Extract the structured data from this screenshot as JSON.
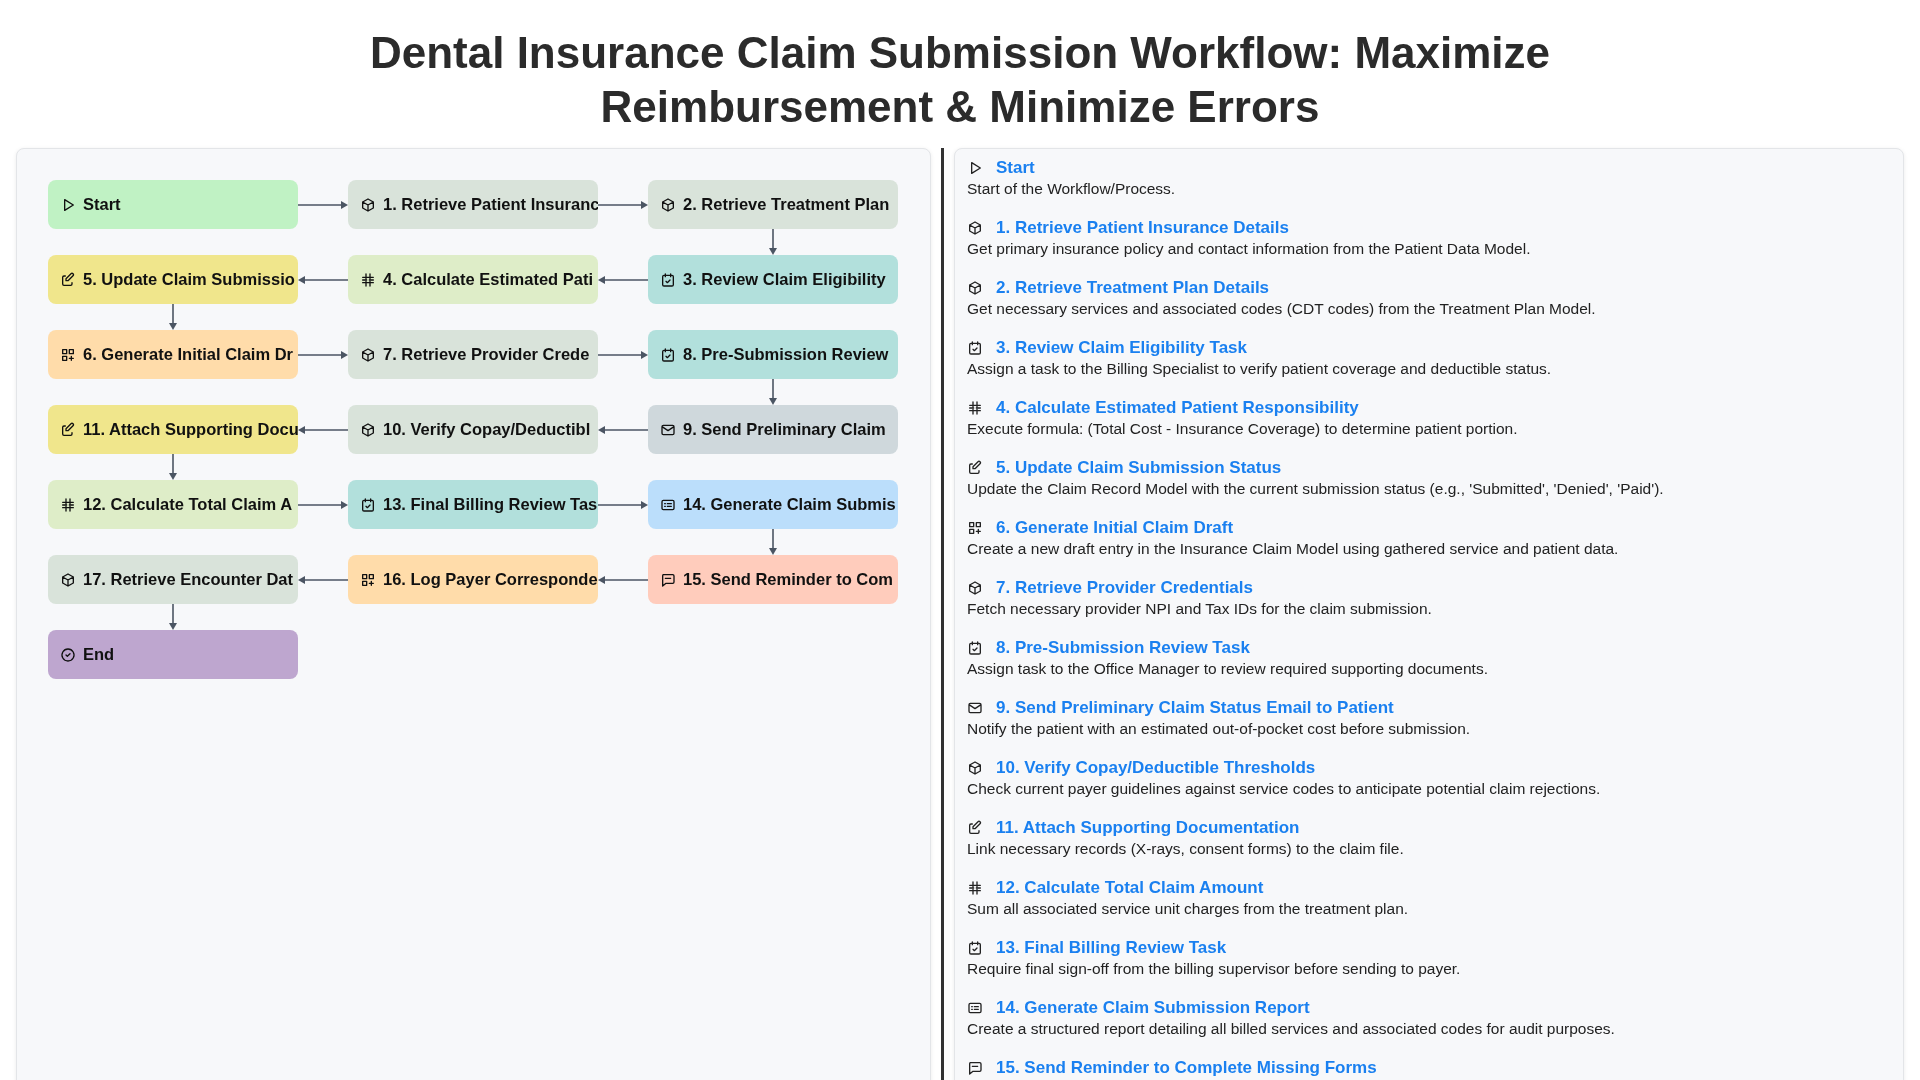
{
  "title": "Dental Insurance Claim Submission Workflow: Maximize Reimbursement & Minimize Errors",
  "flowchart": {
    "rows": [
      {
        "reversed": false,
        "nodes": [
          {
            "label": "Start",
            "kind": "start"
          },
          {
            "label": "1. Retrieve Patient Insuranc",
            "kind": "retrieve"
          },
          {
            "label": "2. Retrieve Treatment Plan",
            "kind": "retrieve"
          }
        ]
      },
      {
        "reversed": true,
        "nodes": [
          {
            "label": "5. Update Claim Submissio",
            "kind": "update"
          },
          {
            "label": "4. Calculate Estimated Pati",
            "kind": "calculate"
          },
          {
            "label": "3. Review Claim Eligibility",
            "kind": "task"
          }
        ]
      },
      {
        "reversed": false,
        "nodes": [
          {
            "label": "6. Generate Initial Claim Dr",
            "kind": "add"
          },
          {
            "label": "7. Retrieve Provider Crede",
            "kind": "retrieve"
          },
          {
            "label": "8. Pre-Submission Review",
            "kind": "task"
          }
        ]
      },
      {
        "reversed": true,
        "nodes": [
          {
            "label": "11. Attach Supporting Docu",
            "kind": "update"
          },
          {
            "label": "10. Verify Copay/Deductibl",
            "kind": "retrieve"
          },
          {
            "label": "9. Send Preliminary Claim",
            "kind": "email"
          }
        ]
      },
      {
        "reversed": false,
        "nodes": [
          {
            "label": "12. Calculate Total Claim A",
            "kind": "calculate"
          },
          {
            "label": "13. Final Billing Review Tas",
            "kind": "task"
          },
          {
            "label": "14. Generate Claim Submis",
            "kind": "report"
          }
        ]
      },
      {
        "reversed": true,
        "nodes": [
          {
            "label": "17. Retrieve Encounter Dat",
            "kind": "retrieve"
          },
          {
            "label": "16. Log Payer Corresponde",
            "kind": "add"
          },
          {
            "label": "15. Send Reminder to Com",
            "kind": "sms"
          }
        ]
      },
      {
        "nodes": [
          {
            "label": "End",
            "kind": "end"
          }
        ]
      }
    ]
  },
  "details": [
    {
      "kind": "start",
      "title": "Start",
      "description": "Start of the Workflow/Process."
    },
    {
      "kind": "retrieve",
      "title": "1. Retrieve Patient Insurance Details",
      "description": "Get primary insurance policy and contact information from the Patient Data Model."
    },
    {
      "kind": "retrieve",
      "title": "2. Retrieve Treatment Plan Details",
      "description": "Get necessary services and associated codes (CDT codes) from the Treatment Plan Model."
    },
    {
      "kind": "task",
      "title": "3. Review Claim Eligibility Task",
      "description": "Assign a task to the Billing Specialist to verify patient coverage and deductible status."
    },
    {
      "kind": "calculate",
      "title": "4. Calculate Estimated Patient Responsibility",
      "description": "Execute formula: (Total Cost - Insurance Coverage) to determine patient portion."
    },
    {
      "kind": "update",
      "title": "5. Update Claim Submission Status",
      "description": "Update the Claim Record Model with the current submission status (e.g., 'Submitted', 'Denied', 'Paid')."
    },
    {
      "kind": "add",
      "title": "6. Generate Initial Claim Draft",
      "description": "Create a new draft entry in the Insurance Claim Model using gathered service and patient data."
    },
    {
      "kind": "retrieve",
      "title": "7. Retrieve Provider Credentials",
      "description": "Fetch necessary provider NPI and Tax IDs for the claim submission."
    },
    {
      "kind": "task",
      "title": "8. Pre-Submission Review Task",
      "description": "Assign task to the Office Manager to review required supporting documents."
    },
    {
      "kind": "email",
      "title": "9. Send Preliminary Claim Status Email to Patient",
      "description": "Notify the patient with an estimated out-of-pocket cost before submission."
    },
    {
      "kind": "retrieve",
      "title": "10. Verify Copay/Deductible Thresholds",
      "description": "Check current payer guidelines against service codes to anticipate potential claim rejections."
    },
    {
      "kind": "update",
      "title": "11. Attach Supporting Documentation",
      "description": "Link necessary records (X-rays, consent forms) to the claim file."
    },
    {
      "kind": "calculate",
      "title": "12. Calculate Total Claim Amount",
      "description": "Sum all associated service unit charges from the treatment plan."
    },
    {
      "kind": "task",
      "title": "13. Final Billing Review Task",
      "description": "Require final sign-off from the billing supervisor before sending to payer."
    },
    {
      "kind": "report",
      "title": "14. Generate Claim Submission Report",
      "description": "Create a structured report detailing all billed services and associated codes for audit purposes."
    },
    {
      "kind": "sms",
      "title": "15. Send Reminder to Complete Missing Forms"
    }
  ]
}
